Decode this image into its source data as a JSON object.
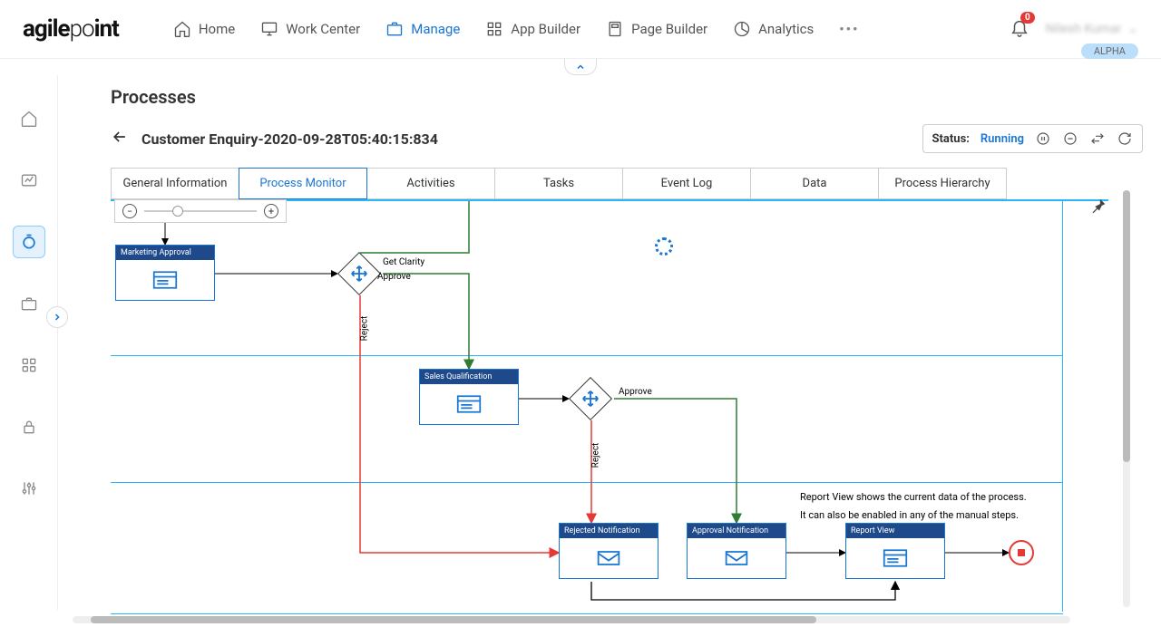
{
  "logo": {
    "part1": "agile",
    "part2": "po",
    "part3": "int"
  },
  "nav": {
    "home": "Home",
    "work_center": "Work Center",
    "manage": "Manage",
    "app_builder": "App Builder",
    "page_builder": "Page Builder",
    "analytics": "Analytics"
  },
  "notifications": {
    "count": "0"
  },
  "user": {
    "name": "Nilesh Kumar"
  },
  "badge": "ALPHA",
  "page": {
    "title": "Processes",
    "process_name": "Customer Enquiry-2020-09-28T05:40:15:834"
  },
  "status": {
    "label": "Status:",
    "value": "Running"
  },
  "tabs": {
    "general": "General Information",
    "monitor": "Process Monitor",
    "activities": "Activities",
    "tasks": "Tasks",
    "event_log": "Event Log",
    "data": "Data",
    "hierarchy": "Process Hierarchy"
  },
  "flow": {
    "marketing_approval": "Marketing Approval",
    "sales_qualification": "Sales Qualification",
    "rejected_notification": "Rejected Notification",
    "approval_notification": "Approval Notification",
    "report_view": "Report View",
    "get_clarity": "Get Clarity",
    "approve_1": "Approve",
    "reject_1": "Reject",
    "approve_2": "Approve",
    "reject_2": "Reject"
  },
  "info": {
    "line1": "Report View shows the current data of the process.",
    "line2": "It can also be enabled in any of the manual steps."
  }
}
